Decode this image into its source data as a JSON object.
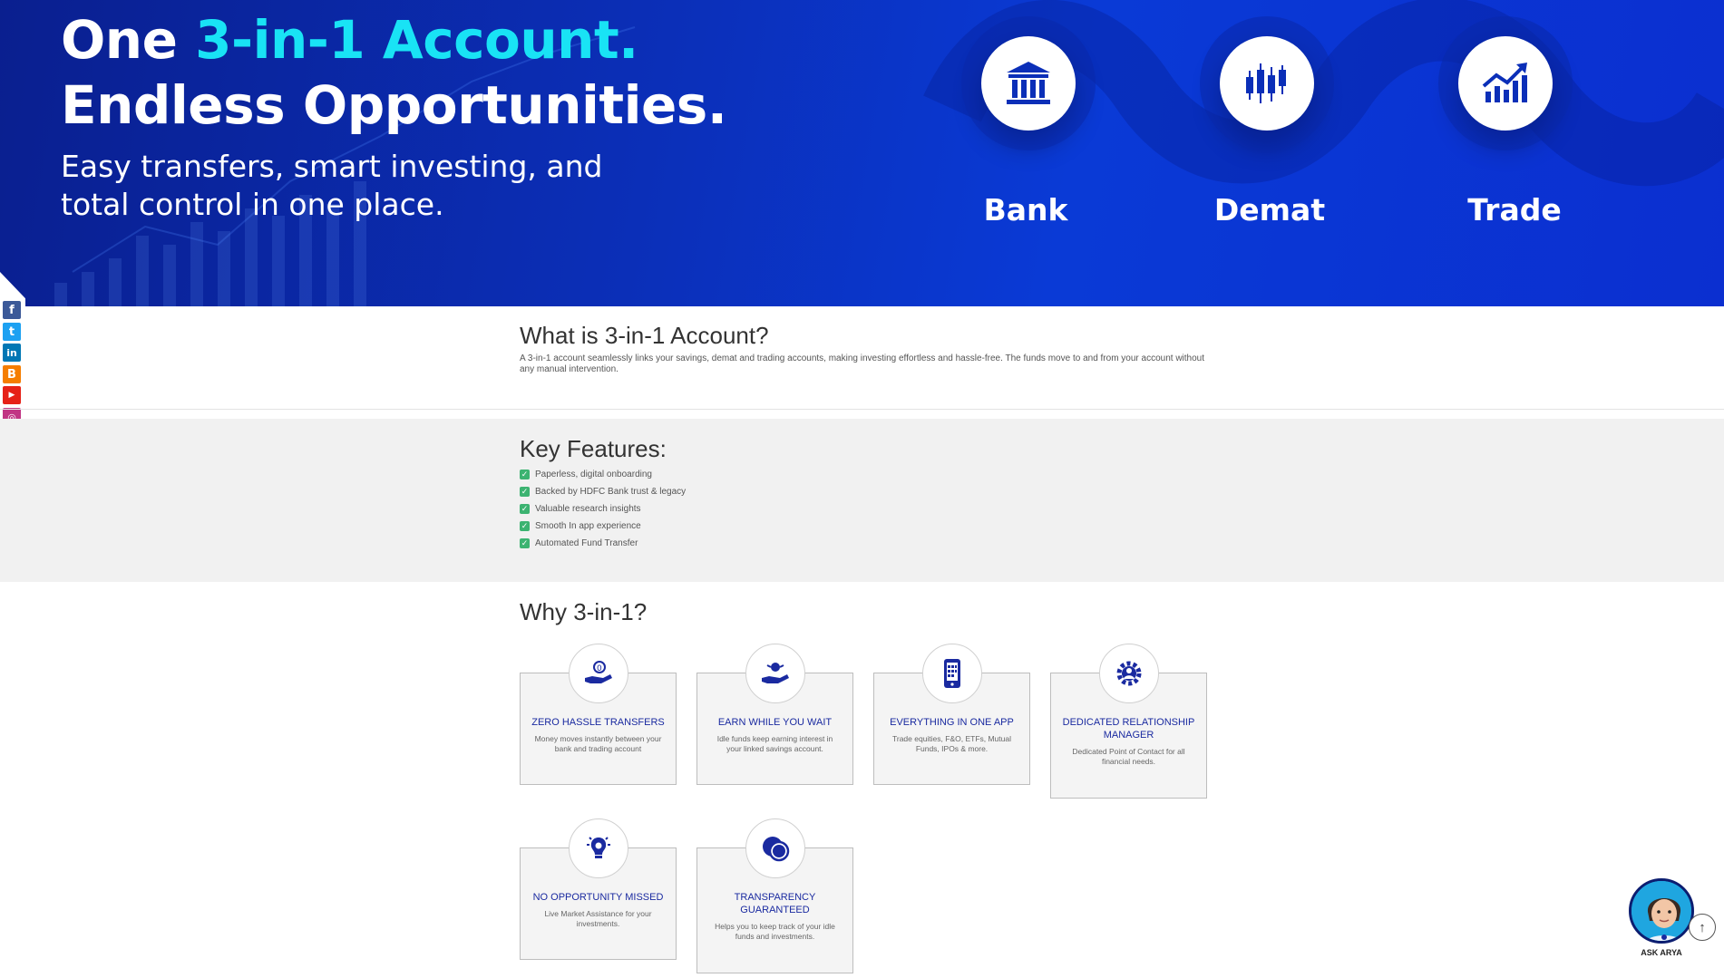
{
  "hero": {
    "title_prefix": "One ",
    "title_accent": "3-in-1 Account.",
    "title_line2": "Endless Opportunities.",
    "subtitle_line1": "Easy transfers, smart investing, and",
    "subtitle_line2": "total control in one place.",
    "pillars": [
      {
        "label": "Bank",
        "icon": "bank-icon"
      },
      {
        "label": "Demat",
        "icon": "candlestick-icon"
      },
      {
        "label": "Trade",
        "icon": "trend-up-icon"
      }
    ]
  },
  "social": [
    "facebook-icon",
    "twitter-icon",
    "linkedin-icon",
    "blogger-icon",
    "youtube-icon",
    "instagram-icon",
    "telegram-icon",
    "share-icon"
  ],
  "what": {
    "title": "What is 3-in-1 Account?",
    "description": "A 3-in-1 account seamlessly links your savings, demat and trading accounts, making investing effortless and hassle-free. The funds move to and from your account without any manual intervention."
  },
  "features": {
    "title": "Key Features:",
    "items": [
      "Paperless, digital onboarding",
      "Backed by HDFC Bank trust & legacy",
      "Valuable research insights",
      "Smooth In app experience",
      "Automated Fund Transfer"
    ]
  },
  "why": {
    "title": "Why 3-in-1?",
    "cards": [
      {
        "title": "ZERO HASSLE TRANSFERS",
        "text": "Money moves instantly between your bank and trading account",
        "icon": "hand-coin-icon"
      },
      {
        "title": "EARN WHILE YOU WAIT",
        "text": "Idle funds keep earning interest in your linked savings account.",
        "icon": "hand-money-icon"
      },
      {
        "title": "EVERYTHING IN ONE APP",
        "text": "Trade equities, F&O, ETFs, Mutual Funds, IPOs & more.",
        "icon": "mobile-icon"
      },
      {
        "title": "DEDICATED RELATIONSHIP MANAGER",
        "text": "Dedicated Point of Contact for all financial needs.",
        "icon": "gear-person-icon"
      },
      {
        "title": "NO OPPORTUNITY MISSED",
        "text": "Live Market Assistance for your investments.",
        "icon": "bulb-icon"
      },
      {
        "title": "TRANSPARENCY GUARANTEED",
        "text": "Helps you to keep track of your idle funds and investments.",
        "icon": "coins-icon"
      }
    ]
  },
  "assistant": {
    "label": "ASK ARYA"
  },
  "colors": {
    "hero_bg": "#0b2fb8",
    "accent_cyan": "#19e3f5",
    "card_title": "#1a2aa0",
    "check_green": "#3cb371"
  }
}
